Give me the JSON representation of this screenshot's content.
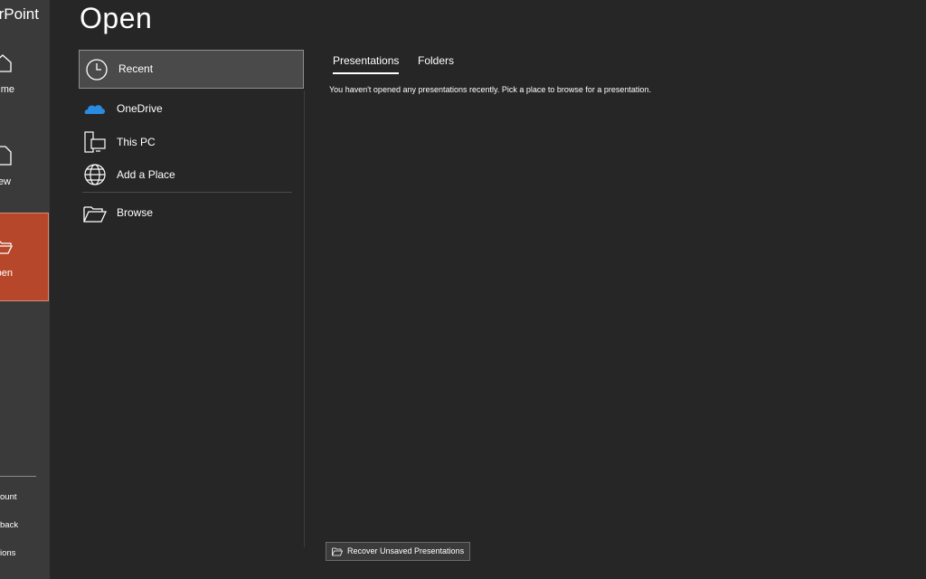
{
  "sidebar": {
    "app_name": "rPoint",
    "items": [
      {
        "label": "me",
        "icon": "home-icon"
      },
      {
        "label": "ew",
        "icon": "new-file-icon"
      },
      {
        "label": "pen",
        "icon": "open-folder-icon",
        "selected": true
      }
    ],
    "links": [
      "ount",
      "back",
      "ions"
    ]
  },
  "main": {
    "title": "Open",
    "places": [
      {
        "label": "Recent",
        "icon": "clock-icon",
        "selected": true
      },
      {
        "label": "OneDrive",
        "icon": "cloud-icon"
      },
      {
        "label": "This PC",
        "icon": "computer-icon"
      },
      {
        "label": "Add a Place",
        "icon": "globe-icon"
      },
      {
        "label": "Browse",
        "icon": "folder-icon"
      }
    ],
    "tabs": [
      {
        "label": "Presentations",
        "active": true
      },
      {
        "label": "Folders",
        "active": false
      }
    ],
    "empty_message": "You haven't opened any presentations recently. Pick a place to browse for a presentation.",
    "recover_button": "Recover Unsaved Presentations"
  },
  "colors": {
    "background": "#262626",
    "sidebar": "#3a3a3a",
    "accent": "#b7472a",
    "onedrive_blue": "#2b8be0"
  }
}
